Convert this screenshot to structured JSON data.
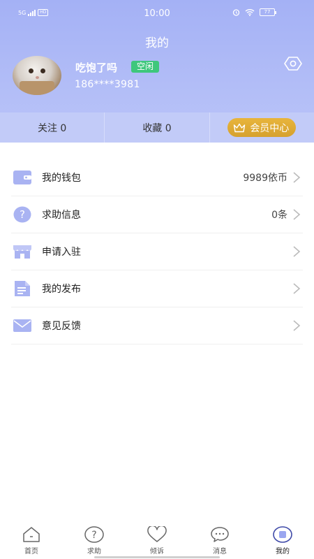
{
  "status_bar": {
    "network": "5G",
    "network_badge": "HD",
    "time": "10:00",
    "battery": "77"
  },
  "header": {
    "title": "我的"
  },
  "profile": {
    "name": "吃饱了吗",
    "status_tag": "空闲",
    "phone": "186****3981"
  },
  "stats": {
    "follow": "关注 0",
    "favorites": "收藏 0",
    "vip": "会员中心"
  },
  "menu": [
    {
      "label": "我的钱包",
      "value": "9989依币",
      "icon": "wallet-icon"
    },
    {
      "label": "求助信息",
      "value": "0条",
      "icon": "question-icon"
    },
    {
      "label": "申请入驻",
      "value": "",
      "icon": "store-icon"
    },
    {
      "label": "我的发布",
      "value": "",
      "icon": "document-icon"
    },
    {
      "label": "意见反馈",
      "value": "",
      "icon": "mail-icon"
    }
  ],
  "tabbar": [
    {
      "label": "首页",
      "icon": "home-icon"
    },
    {
      "label": "求助",
      "icon": "help-icon"
    },
    {
      "label": "倾诉",
      "icon": "heart-icon"
    },
    {
      "label": "消息",
      "icon": "message-icon"
    },
    {
      "label": "我的",
      "icon": "profile-icon"
    }
  ],
  "colors": {
    "accent": "#a4b1f5",
    "icon": "#a9b3f2",
    "tag_green": "#3ec77c",
    "vip_gold": "#d6a12e"
  }
}
